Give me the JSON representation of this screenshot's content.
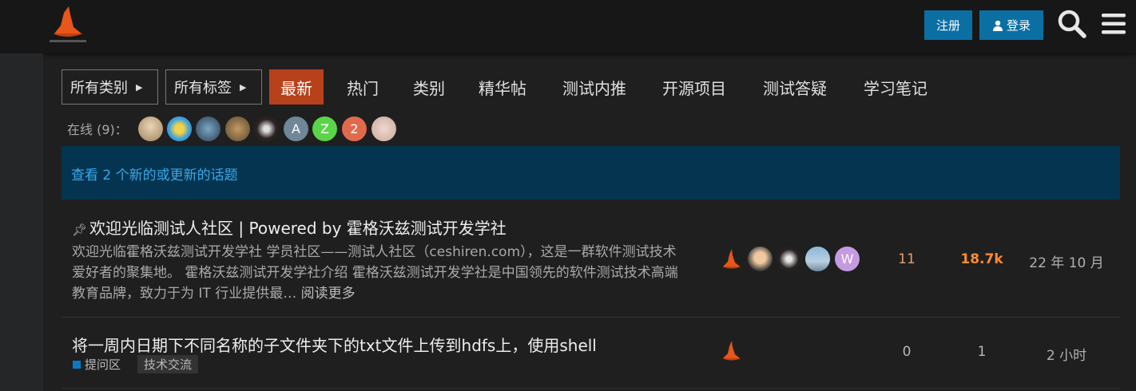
{
  "header": {
    "signup_label": "注册",
    "login_label": "登录",
    "search_icon": "search-icon",
    "menu_icon": "hamburger-icon"
  },
  "nav": {
    "categories_dropdown": "所有类别",
    "tags_dropdown": "所有标签",
    "tabs": [
      "最新",
      "热门",
      "类别",
      "精华帖",
      "测试内推",
      "开源项目",
      "测试答疑",
      "学习笔记"
    ],
    "active_tab": "最新"
  },
  "online": {
    "label": "在线 (9)：",
    "avatars": [
      "",
      "",
      "",
      "",
      "",
      "A",
      "Z",
      "2",
      ""
    ]
  },
  "new_topics": {
    "text": "查看 2 个新的或更新的话题"
  },
  "topics": [
    {
      "title": "欢迎光临测试人社区 | Powered by 霍格沃兹测试开发学社",
      "pinned": true,
      "excerpt": "欢迎光临霍格沃兹测试开发学社 学员社区——测试人社区（ceshiren.com），这是一群软件测试技术爱好者的聚集地。 霍格沃兹测试开发学社介绍 霍格沃兹测试开发学社是中国领先的软件测试技术高端教育品牌，致力于为 IT 行业提供最…",
      "read_more": "阅读更多",
      "posters": [
        "",
        "",
        "",
        "",
        "W"
      ],
      "replies": "11",
      "views": "18.7k",
      "activity": "22 年 10 月"
    },
    {
      "title": "将一周内日期下不同名称的子文件夹下的txt文件上传到hdfs上，使用shell",
      "category": "提问区",
      "tag": "技术交流",
      "posters": [
        ""
      ],
      "replies": "0",
      "views": "1",
      "activity": "2 小时"
    }
  ],
  "colors": {
    "accent": "#b7411a",
    "button_blue": "#0b6fa4",
    "new_bar_bg": "#04344f",
    "link_blue": "#3aa8e8",
    "views_orange": "#ff8c2e",
    "replies_orange": "#e0a070"
  }
}
